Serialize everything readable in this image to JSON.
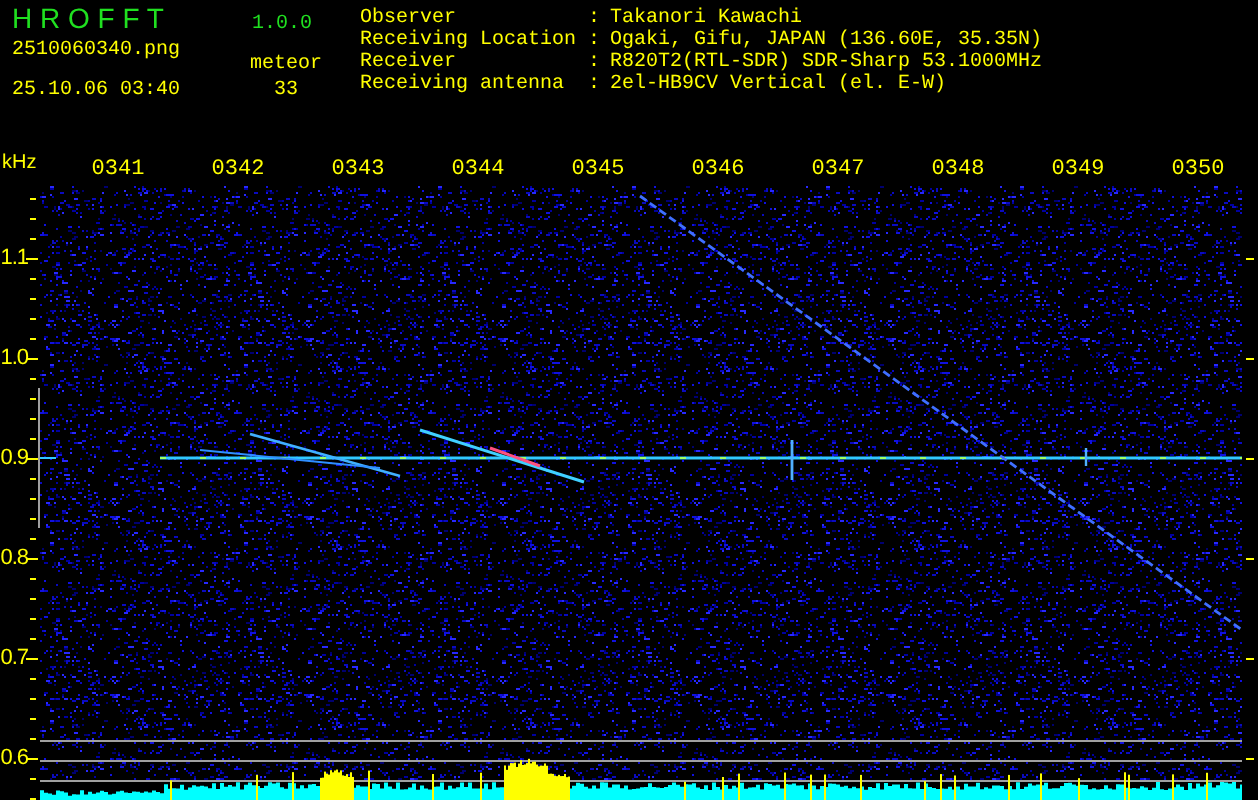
{
  "app": {
    "name": "H R O F F T",
    "version": "1.0.0"
  },
  "file": {
    "name": "2510060340.png",
    "datetime": "25.10.06 03:40"
  },
  "meteor": {
    "label": "meteor",
    "count": "33"
  },
  "station": [
    {
      "label": "Observer",
      "separator": ":",
      "value": "Takanori Kawachi"
    },
    {
      "label": "Receiving Location",
      "separator": ":",
      "value": "Ogaki, Gifu, JAPAN (136.60E, 35.35N)"
    },
    {
      "label": "Receiver",
      "separator": ":",
      "value": "R820T2(RTL-SDR) SDR-Sharp 53.1000MHz"
    },
    {
      "label": "Receiving antenna",
      "separator": ":",
      "value": "2el-HB9CV Vertical (el. E-W)"
    }
  ],
  "spectrogram": {
    "unit": "kHz",
    "time_labels": [
      "0341",
      "0342",
      "0343",
      "0344",
      "0345",
      "0346",
      "0347",
      "0348",
      "0349",
      "0350"
    ],
    "frequency_labels": [
      "1.1",
      "1.0",
      "0.9",
      "0.8",
      "0.7",
      "0.6"
    ]
  }
}
